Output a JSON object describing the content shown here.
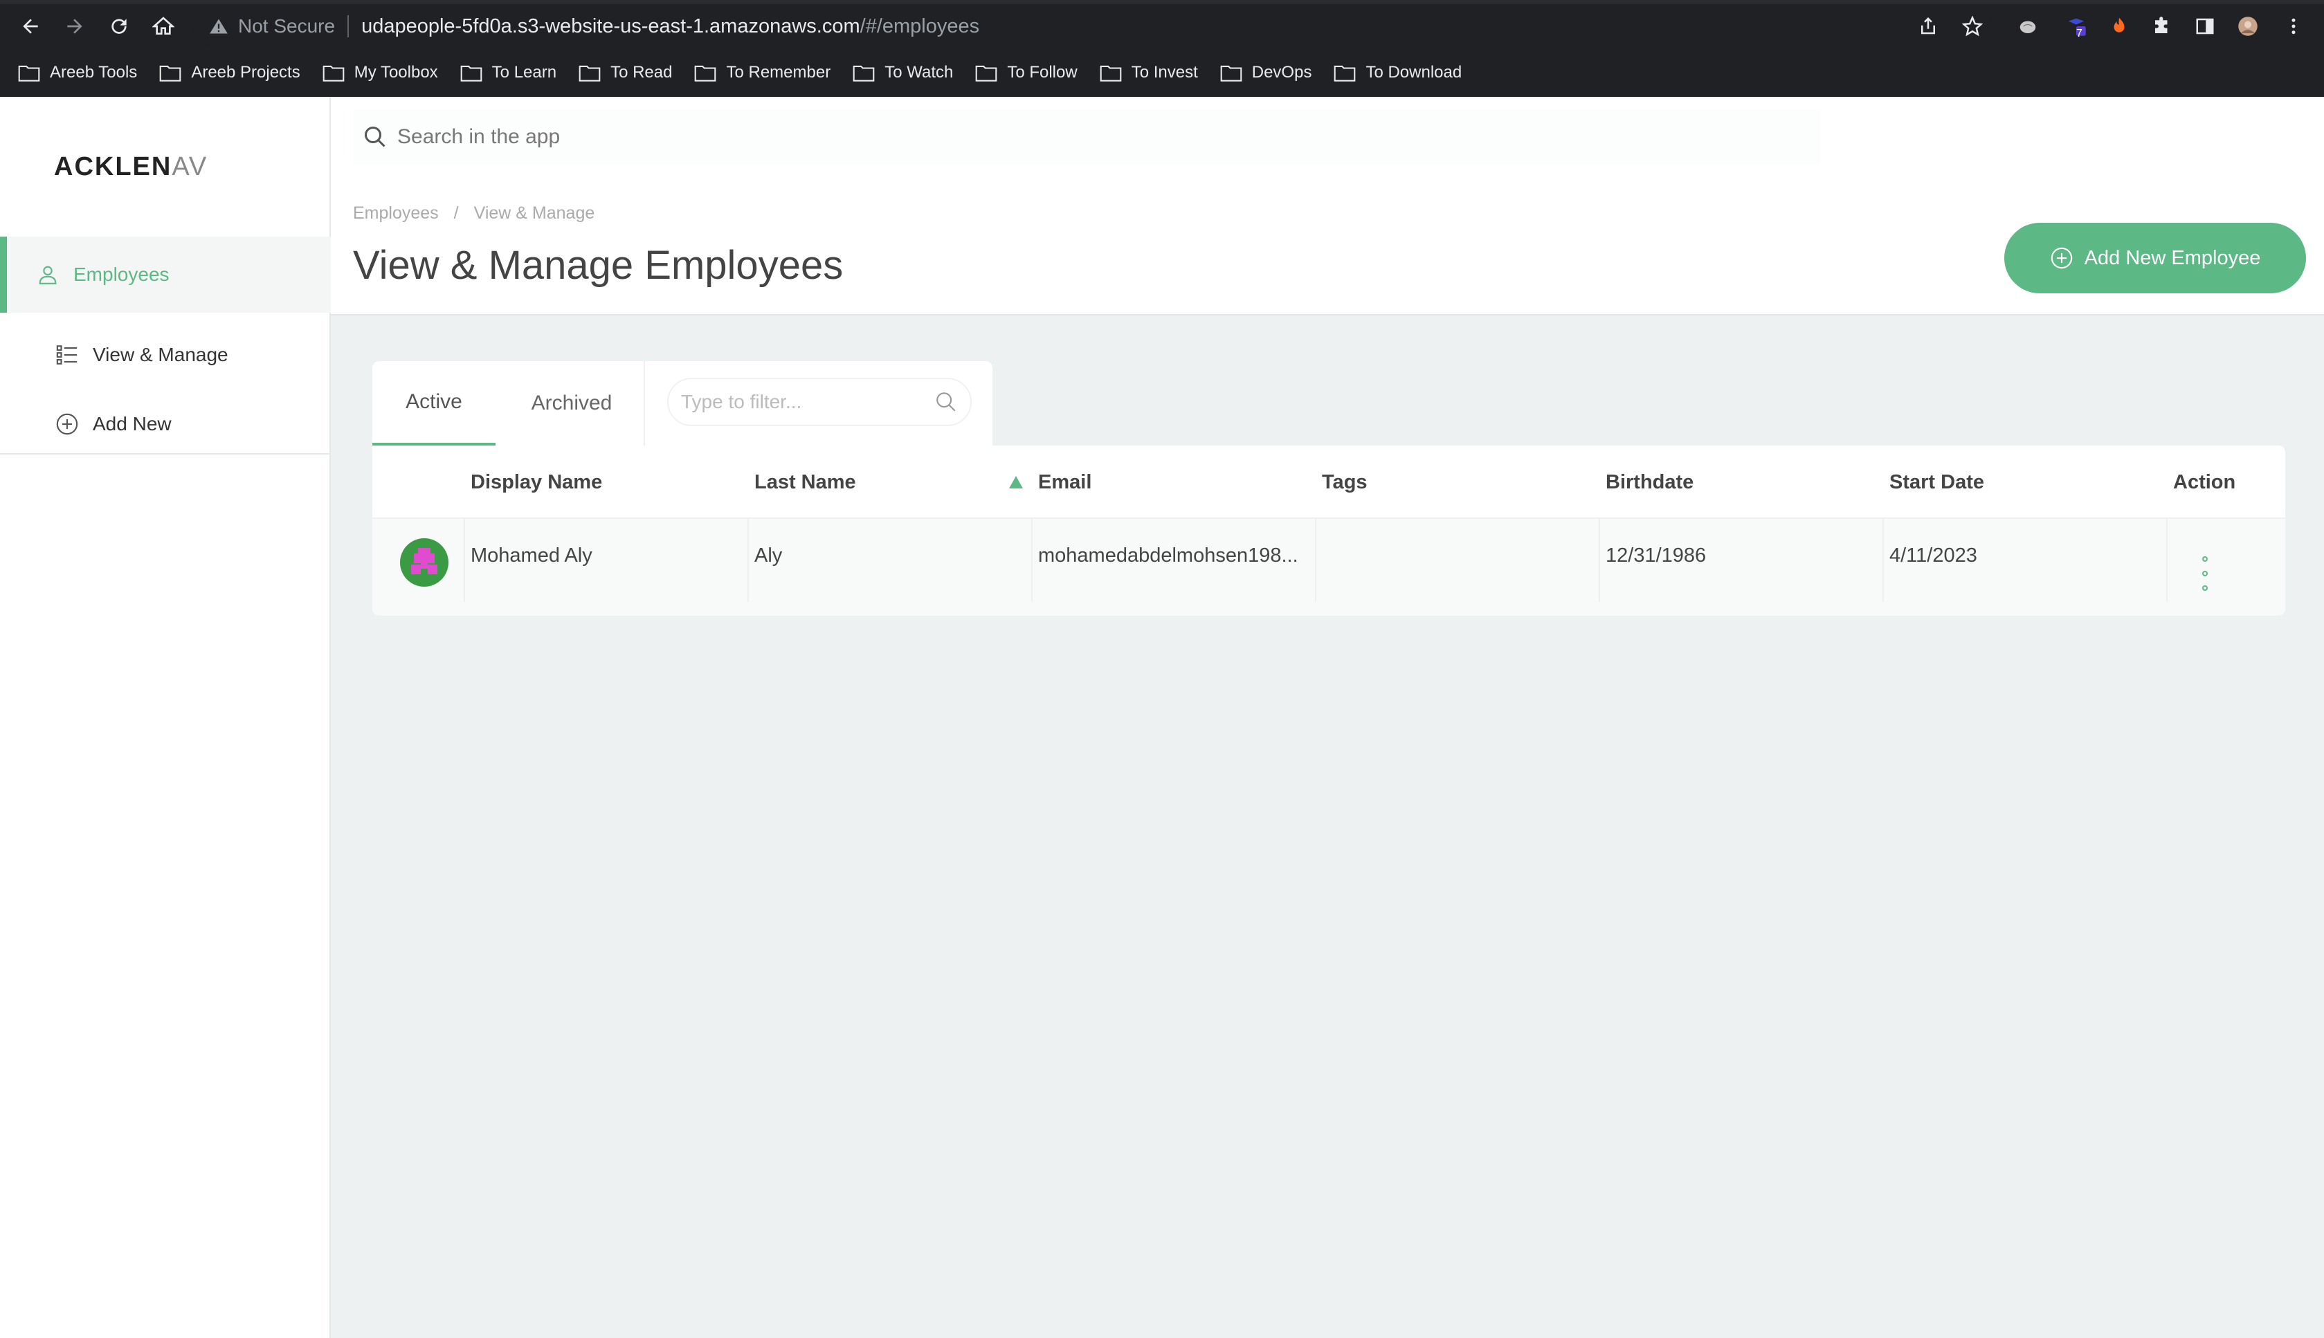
{
  "browser": {
    "security_label": "Not Secure",
    "url_host": "udapeople-5fd0a.s3-website-us-east-1.amazonaws.com",
    "url_path": "/#/employees",
    "extension_badge": "7",
    "bookmarks": [
      {
        "label": "Areeb Tools"
      },
      {
        "label": "Areeb Projects"
      },
      {
        "label": "My Toolbox"
      },
      {
        "label": "To Learn"
      },
      {
        "label": "To Read"
      },
      {
        "label": "To Remember"
      },
      {
        "label": "To Watch"
      },
      {
        "label": "To Follow"
      },
      {
        "label": "To Invest"
      },
      {
        "label": "DevOps"
      },
      {
        "label": "To Download"
      }
    ]
  },
  "app": {
    "logo_main": "ACKLEN",
    "logo_faded": "AV",
    "accent_color": "#5cb985"
  },
  "sidebar": {
    "items": [
      {
        "label": "Employees",
        "icon": "user-icon",
        "active": true
      },
      {
        "label": "View & Manage",
        "icon": "list-icon",
        "active": false
      },
      {
        "label": "Add New",
        "icon": "plus-circle-icon",
        "active": false
      }
    ]
  },
  "header": {
    "search_placeholder": "Search in the app",
    "breadcrumb": [
      "Employees",
      "View & Manage"
    ],
    "breadcrumb_separator": "/",
    "title": "View & Manage Employees",
    "add_button_label": "Add New Employee"
  },
  "tabs": {
    "items": [
      {
        "label": "Active",
        "active": true
      },
      {
        "label": "Archived",
        "active": false
      }
    ],
    "filter_placeholder": "Type to filter..."
  },
  "table": {
    "columns": [
      "Display Name",
      "Last Name",
      "Email",
      "Tags",
      "Birthdate",
      "Start Date",
      "Action"
    ],
    "sorted_column": "Email",
    "rows": [
      {
        "display_name": "Mohamed Aly",
        "last_name": "Aly",
        "email": "mohamedabdelmohsen198...",
        "tags": "",
        "birthdate": "12/31/1986",
        "start_date": "4/11/2023"
      }
    ]
  }
}
